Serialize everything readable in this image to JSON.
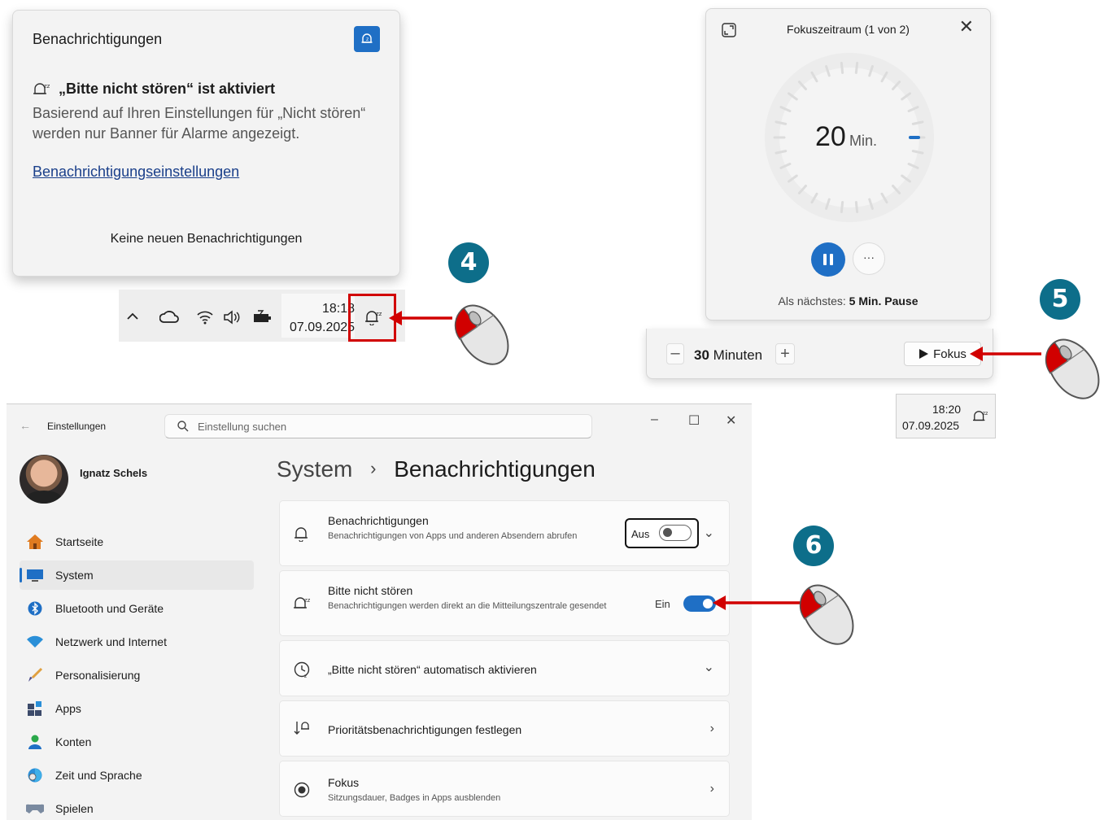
{
  "notification_flyout": {
    "title": "Benachrichtigungen",
    "dnd_heading": "„Bitte nicht stören“ ist aktiviert",
    "dnd_description": "Basierend auf Ihren Einstellungen für „Nicht stören“ werden nur Banner für Alarme angezeigt.",
    "settings_link": "Benachrichtigungseinstellungen",
    "empty_text": "Keine neuen Benachrichtigungen"
  },
  "taskbar_1": {
    "time": "18:18",
    "date": "07.09.2025",
    "icons": [
      "chevron-up-icon",
      "cloud-icon",
      "wifi-icon",
      "speaker-icon",
      "battery-icon",
      "bell-dnd-icon"
    ]
  },
  "focus_timer": {
    "title": "Fokuszeitraum (1 von 2)",
    "minutes_value": "20",
    "minutes_unit": "Min.",
    "next_prefix": "Als nächstes:",
    "next_value": "5 Min. Pause",
    "more_label": "···"
  },
  "focus_bar": {
    "minus": "–",
    "duration_value": "30",
    "duration_unit": "Minuten",
    "plus": "+",
    "start_label": "Fokus"
  },
  "taskbar_2": {
    "time": "18:20",
    "date": "07.09.2025"
  },
  "settings": {
    "app_title": "Einstellungen",
    "search_placeholder": "Einstellung suchen",
    "user_name": "Ignatz Schels",
    "breadcrumb_parent": "System",
    "breadcrumb_separator": "›",
    "breadcrumb_current": "Benachrichtigungen",
    "nav": [
      {
        "label": "Startseite",
        "icon": "home-icon"
      },
      {
        "label": "System",
        "icon": "monitor-icon",
        "active": true
      },
      {
        "label": "Bluetooth und Geräte",
        "icon": "bluetooth-icon"
      },
      {
        "label": "Netzwerk und Internet",
        "icon": "network-icon"
      },
      {
        "label": "Personalisierung",
        "icon": "brush-icon"
      },
      {
        "label": "Apps",
        "icon": "apps-icon"
      },
      {
        "label": "Konten",
        "icon": "account-icon"
      },
      {
        "label": "Zeit und Sprache",
        "icon": "globe-clock-icon"
      },
      {
        "label": "Spielen",
        "icon": "gamepad-icon"
      }
    ],
    "cards": {
      "notifications": {
        "title": "Benachrichtigungen",
        "subtitle": "Benachrichtigungen von Apps und anderen Absendern abrufen",
        "state": "Aus"
      },
      "dnd": {
        "title": "Bitte nicht stören",
        "subtitle": "Benachrichtigungen werden direkt an die Mitteilungszentrale gesendet",
        "state": "Ein"
      },
      "auto_dnd": {
        "title": "„Bitte nicht stören“ automatisch aktivieren"
      },
      "priority": {
        "title": "Prioritätsbenachrichtigungen festlegen"
      },
      "focus": {
        "title": "Fokus",
        "subtitle": "Sitzungsdauer, Badges in Apps ausblenden"
      }
    }
  },
  "steps": [
    "4",
    "5",
    "6"
  ],
  "colors": {
    "accent": "#1f6fc5",
    "arrow": "#d10000",
    "step_badge": "#0d6e8a"
  }
}
